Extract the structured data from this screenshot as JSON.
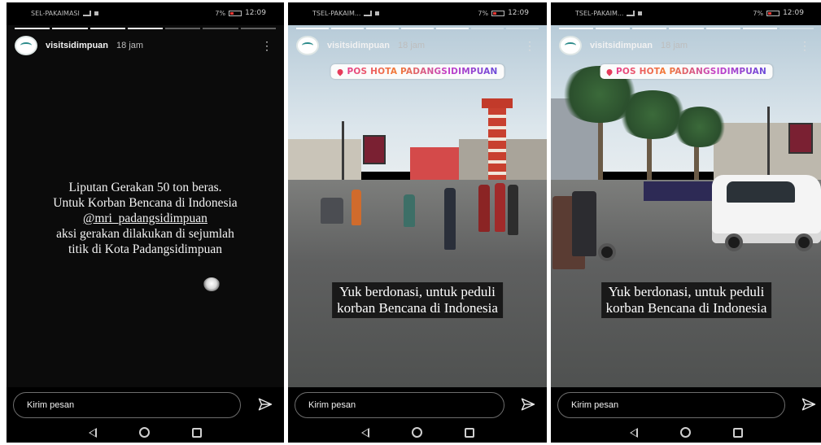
{
  "colors": {
    "background": "#000000",
    "location_accent": "#e6408a",
    "caption_box": "#141414"
  },
  "panels": [
    {
      "status": {
        "carrier": "SEL-PAKAIMASI",
        "battery": "7%",
        "time": "12:09"
      },
      "story": {
        "username": "visitsidimpuan",
        "time": "18 jam",
        "segments": 7,
        "active_segment": 5
      },
      "caption_lines": [
        "Liputan Gerakan 50 ton beras.",
        "Untuk Korban Bencana di Indonesia",
        "@mri_padangsidimpuan",
        "aksi gerakan dilakukan di sejumlah",
        "titik di Kota Padangsidimpuan"
      ],
      "reply_placeholder": "Kirim pesan"
    },
    {
      "status": {
        "carrier": "TSEL-PAKAIM...",
        "battery": "7%",
        "time": "12:09"
      },
      "story": {
        "username": "visitsidimpuan",
        "time": "18 jam",
        "segments": 7,
        "active_segment": 6
      },
      "location_sticker": "POS HOTA PADANGSIDIMPUAN",
      "caption_lines": [
        "Yuk berdonasi, untuk peduli",
        "korban Bencana di Indonesia"
      ],
      "reply_placeholder": "Kirim pesan"
    },
    {
      "status": {
        "carrier": "TSEL-PAKAIM...",
        "battery": "7%",
        "time": "12:09"
      },
      "story": {
        "username": "visitsidimpuan",
        "time": "18 jam",
        "segments": 7,
        "active_segment": 7
      },
      "location_sticker": "POS HOTA PADANGSIDIMPUAN",
      "caption_lines": [
        "Yuk berdonasi, untuk peduli",
        "korban Bencana di Indonesia"
      ],
      "reply_placeholder": "Kirim pesan"
    }
  ],
  "icons": {
    "send": "send-icon",
    "more": "more-options-icon",
    "nav": [
      "back-icon",
      "home-icon",
      "recent-apps-icon"
    ]
  }
}
